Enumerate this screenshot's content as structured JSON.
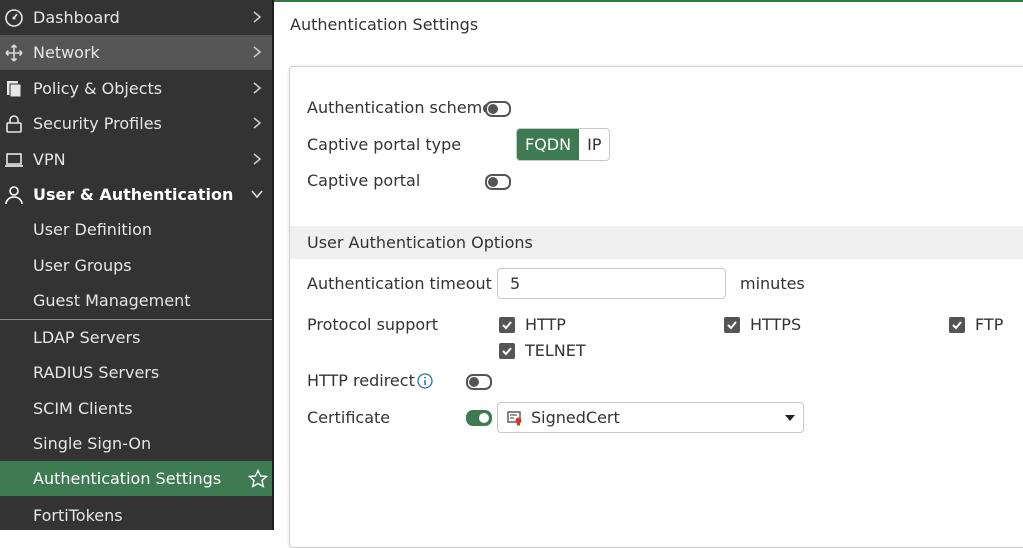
{
  "sidebar": {
    "items": [
      {
        "label": "Dashboard",
        "icon": "dashboard-icon"
      },
      {
        "label": "Network",
        "icon": "network-icon"
      },
      {
        "label": "Policy & Objects",
        "icon": "policy-icon"
      },
      {
        "label": "Security Profiles",
        "icon": "lock-icon"
      },
      {
        "label": "VPN",
        "icon": "laptop-icon"
      },
      {
        "label": "User & Authentication",
        "icon": "user-icon"
      }
    ],
    "subitems": [
      {
        "label": "User Definition"
      },
      {
        "label": "User Groups"
      },
      {
        "label": "Guest Management"
      },
      {
        "label": "LDAP Servers"
      },
      {
        "label": "RADIUS Servers"
      },
      {
        "label": "SCIM Clients"
      },
      {
        "label": "Single Sign-On"
      },
      {
        "label": "Authentication Settings"
      },
      {
        "label": "FortiTokens"
      }
    ]
  },
  "page": {
    "title": "Authentication Settings"
  },
  "form": {
    "auth_scheme": {
      "label": "Authentication scheme",
      "enabled": false
    },
    "captive_portal_type": {
      "label": "Captive portal type",
      "options": [
        "FQDN",
        "IP"
      ],
      "selected": "FQDN"
    },
    "captive_portal": {
      "label": "Captive portal",
      "enabled": false
    },
    "section_title": "User Authentication Options",
    "auth_timeout": {
      "label": "Authentication timeout",
      "value": "5",
      "unit": "minutes"
    },
    "protocol_support": {
      "label": "Protocol support",
      "options": [
        {
          "label": "HTTP",
          "checked": true
        },
        {
          "label": "HTTPS",
          "checked": true
        },
        {
          "label": "FTP",
          "checked": true
        },
        {
          "label": "TELNET",
          "checked": true
        }
      ]
    },
    "http_redirect": {
      "label": "HTTP redirect",
      "enabled": false
    },
    "certificate": {
      "label": "Certificate",
      "enabled": true,
      "value": "SignedCert"
    }
  },
  "colors": {
    "accent": "#3e7a52",
    "sidebar_bg": "#333333",
    "sidebar_hover": "#555555"
  }
}
